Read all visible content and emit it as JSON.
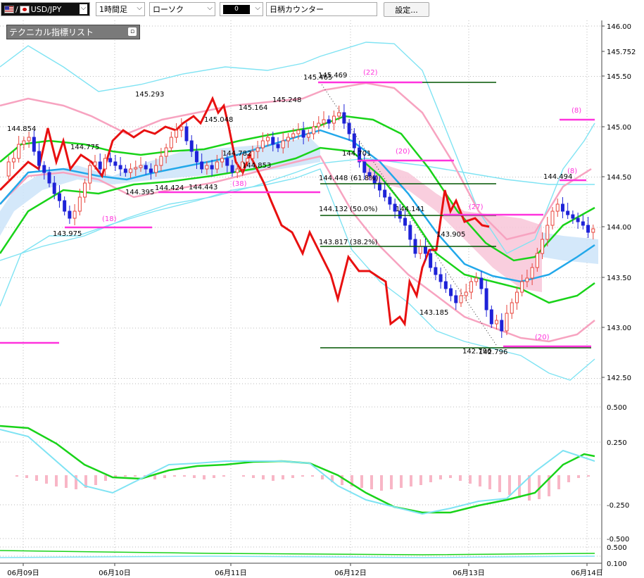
{
  "toolbar": {
    "symbol": "USD/JPY",
    "timeframe": "1時間足",
    "chart_type": "ローソク",
    "color_select": "0",
    "search_placeholder": "日柄カウンター",
    "settings_label": "設定..."
  },
  "panel": {
    "title": "テクニカル指標リスト"
  },
  "colors": {
    "up": "#e8453c",
    "down": "#1e22d8",
    "ichimoku_red": "#e81010",
    "bb_pink": "#f7a3c0",
    "bb_cyan": "#7fe3f3",
    "ma_green": "#19d319",
    "ma_blue": "#22a8ea",
    "magenta": "#ff33dd",
    "fib": "#005500"
  },
  "chart_data": {
    "type": "candlestick",
    "price_axis": {
      "ticks": [
        "146.00",
        "145.752",
        "145.50",
        "145.00",
        "144.50",
        "144.00",
        "143.50",
        "143.00",
        "142.50"
      ],
      "ylim": [
        142.3,
        146.1
      ]
    },
    "macd_axis": {
      "ticks": [
        "0.500",
        "0.250",
        "-0.250",
        "-0.500"
      ]
    },
    "sub_axis": {
      "ticks": [
        "0.500",
        "0.100"
      ]
    },
    "dates": [
      "06月09日",
      "06月10日",
      "06月11日",
      "06月12日",
      "06月13日",
      "06月14日"
    ],
    "price_labels": [
      "144.854",
      "144.775",
      "143.975",
      "145.293",
      "144.395",
      "144.424",
      "144.443",
      "145.048",
      "144.782",
      "144.853",
      "145.164",
      "145.248",
      "145.465",
      "145.469",
      "144.701",
      "144.448",
      "144.132",
      "143.817",
      "144.141",
      "143.905",
      "143.185",
      "142.796",
      "144.494",
      "142.796"
    ],
    "fib_labels": [
      "(61.8%)",
      "(50.0%)",
      "(38.2%)"
    ],
    "counter_labels": [
      "(22)",
      "(20)",
      "(38)",
      "(18)",
      "(27)",
      "(20)",
      "(8)",
      "(8)"
    ]
  }
}
